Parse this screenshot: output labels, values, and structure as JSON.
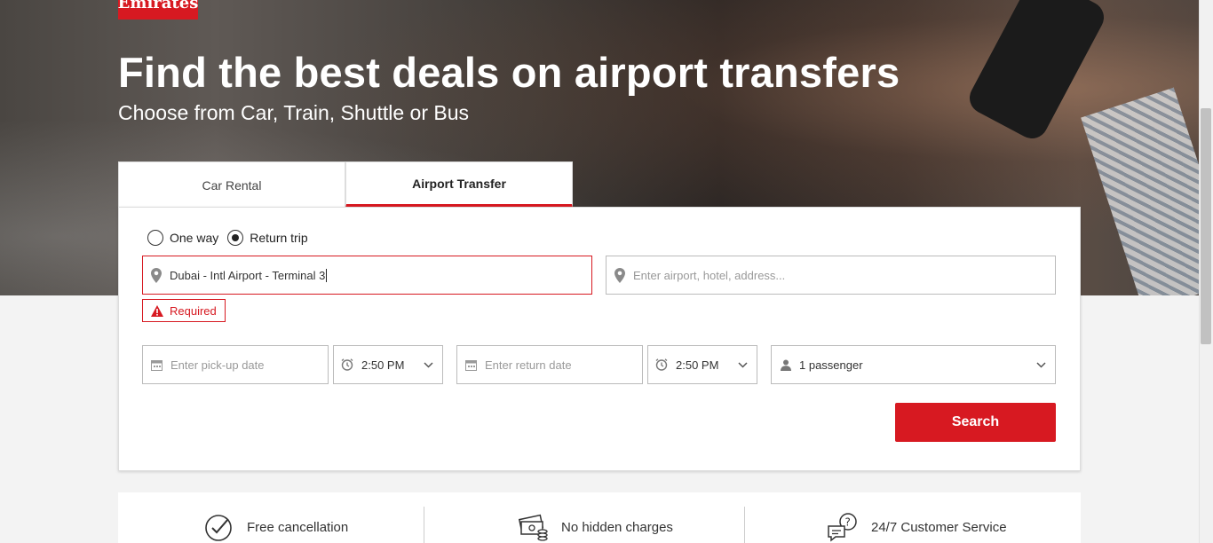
{
  "brand": {
    "logo_text": "Emirates",
    "accent_color": "#d71921"
  },
  "hero": {
    "title": "Find the best deals on airport transfers",
    "subtitle": "Choose from Car, Train, Shuttle or Bus"
  },
  "tabs": [
    {
      "label": "Car Rental",
      "active": false
    },
    {
      "label": "Airport Transfer",
      "active": true
    }
  ],
  "trip_type": {
    "options": [
      {
        "label": "One way",
        "selected": false
      },
      {
        "label": "Return trip",
        "selected": true
      }
    ]
  },
  "pickup_location": {
    "value": "Dubai - Intl Airport - Terminal 3",
    "error": "Required",
    "icon": "location-pin-icon"
  },
  "dropoff_location": {
    "placeholder": "Enter airport, hotel, address...",
    "icon": "location-pin-icon"
  },
  "pickup_date": {
    "placeholder": "Enter pick-up date",
    "icon": "calendar-icon"
  },
  "pickup_time": {
    "value": "2:50 PM",
    "icon": "clock-icon"
  },
  "return_date": {
    "placeholder": "Enter return date",
    "icon": "calendar-icon"
  },
  "return_time": {
    "value": "2:50 PM",
    "icon": "clock-icon"
  },
  "passengers": {
    "value": "1 passenger",
    "icon": "person-icon"
  },
  "search_button": {
    "label": "Search"
  },
  "features": [
    {
      "label": "Free cancellation",
      "icon": "check-circle-icon"
    },
    {
      "label": "No hidden charges",
      "icon": "money-icon"
    },
    {
      "label": "24/7 Customer Service",
      "icon": "chat-support-icon"
    }
  ]
}
